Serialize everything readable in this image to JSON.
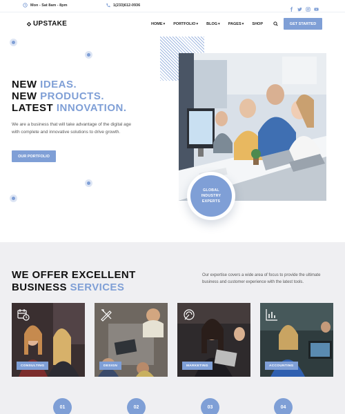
{
  "topbar": {
    "hours": "Mon - Sat 8am - 8pm",
    "phone": "1(233)612-0936",
    "social": [
      "facebook-icon",
      "twitter-icon",
      "instagram-icon",
      "youtube-icon"
    ]
  },
  "header": {
    "logo": "UPSTAKE",
    "nav": [
      "HOME",
      "PORTFOLIO",
      "BLOG",
      "PAGES",
      "SHOP"
    ],
    "cta": "GET STARTED"
  },
  "hero": {
    "line1_a": "NEW ",
    "line1_b": "IDEAS.",
    "line2_a": "NEW ",
    "line2_b": "PRODUCTS.",
    "line3_a": "LATEST ",
    "line3_b": "INNOVATION.",
    "description": "We are a business that will take advantage of the digital age with complete and innovative solutions to drive growth.",
    "button": "OUR PORTFOLIO",
    "badge": "GLOBAL INDUSTRY EXPERTS"
  },
  "services": {
    "title_line1": "WE OFFER EXCELLENT",
    "title_line2_a": "BUSINESS ",
    "title_line2_b": "SERVICES",
    "description": "Our expertise covers a wide area of focus to provide the ultimate business and customer experience with the latest tools.",
    "cards": [
      {
        "label": "CONSULTING",
        "icon": "calendar-clock-icon"
      },
      {
        "label": "DESIGN",
        "icon": "design-tools-icon"
      },
      {
        "label": "MARKETING",
        "icon": "megaphone-icon"
      },
      {
        "label": "ACCOUNTING",
        "icon": "bar-chart-icon"
      }
    ],
    "steps": [
      "01",
      "02",
      "03",
      "04"
    ]
  },
  "colors": {
    "accent": "#7f9fd6",
    "section_bg": "#efeff2"
  }
}
